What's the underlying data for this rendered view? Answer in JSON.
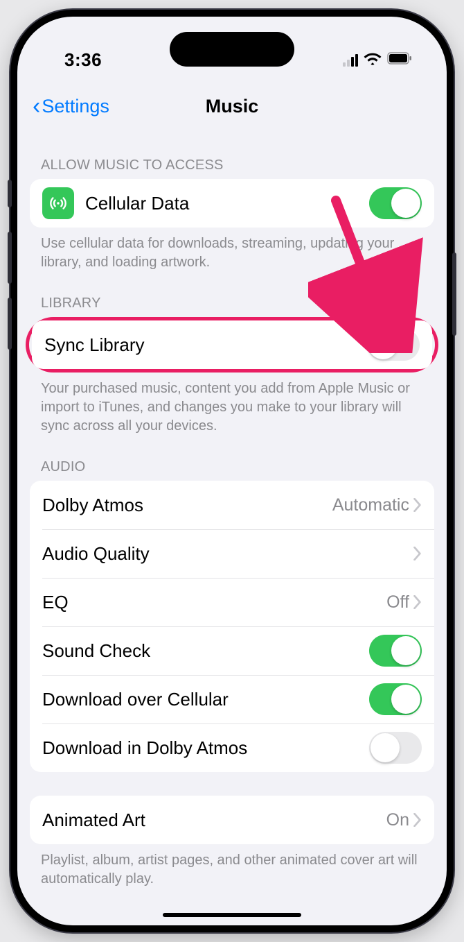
{
  "status": {
    "time": "3:36"
  },
  "nav": {
    "back": "Settings",
    "title": "Music"
  },
  "sections": {
    "access": {
      "header": "ALLOW MUSIC TO ACCESS",
      "cellular_label": "Cellular Data",
      "cellular_on": true,
      "footer": "Use cellular data for downloads, streaming, updating your library, and loading artwork."
    },
    "library": {
      "header": "LIBRARY",
      "sync_label": "Sync Library",
      "sync_on": false,
      "footer": "Your purchased music, content you add from Apple Music or import to iTunes, and changes you make to your library will sync across all your devices."
    },
    "audio": {
      "header": "AUDIO",
      "dolby_label": "Dolby Atmos",
      "dolby_value": "Automatic",
      "quality_label": "Audio Quality",
      "eq_label": "EQ",
      "eq_value": "Off",
      "soundcheck_label": "Sound Check",
      "soundcheck_on": true,
      "dl_cell_label": "Download over Cellular",
      "dl_cell_on": true,
      "dl_dolby_label": "Download in Dolby Atmos",
      "dl_dolby_on": false
    },
    "art": {
      "animated_label": "Animated Art",
      "animated_value": "On",
      "footer": "Playlist, album, artist pages, and other animated cover art will automatically play."
    }
  },
  "annotation": {
    "highlight_color": "#e91e63",
    "arrow_target": "sync-library-toggle"
  }
}
